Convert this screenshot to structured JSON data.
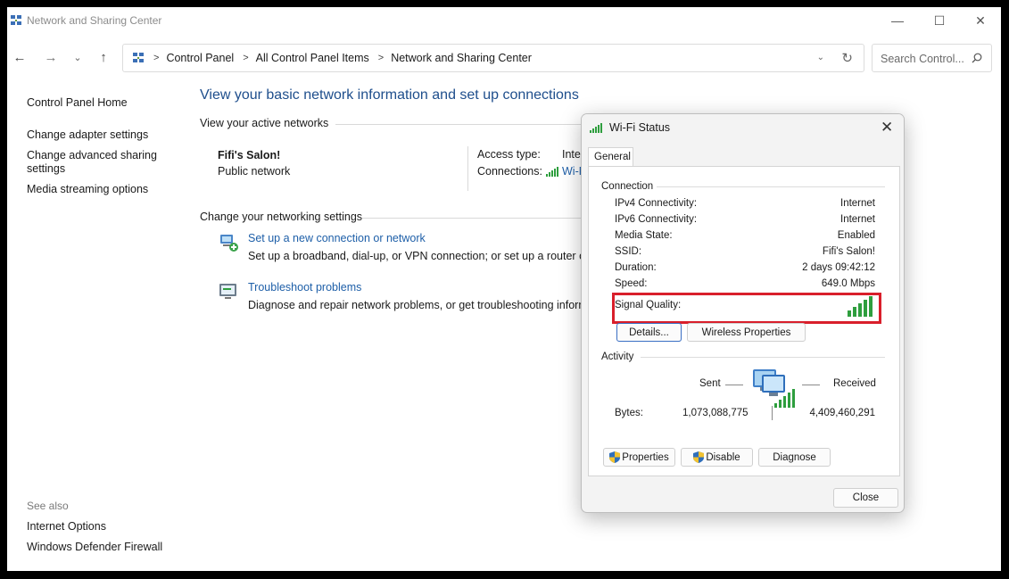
{
  "window": {
    "title": "Network and Sharing Center",
    "minimize_glyph": "—",
    "maximize_glyph": "☐",
    "close_glyph": "✕"
  },
  "nav": {
    "back_glyph": "←",
    "forward_glyph": "→",
    "recent_glyph": "⌄",
    "up_glyph": "↑",
    "breadcrumbs": [
      "Control Panel",
      "All Control Panel Items",
      "Network and Sharing Center"
    ],
    "separator": ">",
    "dropdown_glyph": "⌄",
    "refresh_glyph": "↻",
    "search_placeholder": "Search Control..."
  },
  "sidebar": {
    "home": "Control Panel Home",
    "links": [
      "Change adapter settings",
      "Change advanced sharing settings",
      "Media streaming options"
    ],
    "see_also_label": "See also",
    "see_also": [
      "Internet Options",
      "Windows Defender Firewall"
    ]
  },
  "main": {
    "heading": "View your basic network information and set up connections",
    "active_networks_title": "View your active networks",
    "network_name": "Fifi's Salon!",
    "network_type": "Public network",
    "access_type_label": "Access type:",
    "access_type_value": "Inter",
    "connections_label": "Connections:",
    "connections_value": "Wi-F",
    "change_settings_title": "Change your networking settings",
    "tasks": [
      {
        "link": "Set up a new connection or network",
        "desc": "Set up a broadband, dial-up, or VPN connection; or set up a router or ac"
      },
      {
        "link": "Troubleshoot problems",
        "desc": "Diagnose and repair network problems, or get troubleshooting informa"
      }
    ]
  },
  "dialog": {
    "title": "Wi-Fi Status",
    "close_glyph": "✕",
    "tab": "General",
    "connection_label": "Connection",
    "rows": [
      {
        "label": "IPv4 Connectivity:",
        "value": "Internet"
      },
      {
        "label": "IPv6 Connectivity:",
        "value": "Internet"
      },
      {
        "label": "Media State:",
        "value": "Enabled"
      },
      {
        "label": "SSID:",
        "value": "Fifi's Salon!"
      },
      {
        "label": "Duration:",
        "value": "2 days 09:42:12"
      },
      {
        "label": "Speed:",
        "value": "649.0 Mbps"
      }
    ],
    "signal_quality_label": "Signal Quality:",
    "signal_bars_lit": 5,
    "signal_bars_total": 5,
    "details_button": "Details...",
    "wireless_properties_button": "Wireless Properties",
    "activity_label": "Activity",
    "sent_label": "Sent",
    "received_label": "Received",
    "bytes_label": "Bytes:",
    "bytes_sent": "1,073,088,775",
    "bytes_received": "4,409,460,291",
    "properties_button": "Properties",
    "disable_button": "Disable",
    "diagnose_button": "Diagnose",
    "close_button": "Close",
    "highlight_color": "#d91f2b",
    "signal_color": "#2e9e3e"
  }
}
